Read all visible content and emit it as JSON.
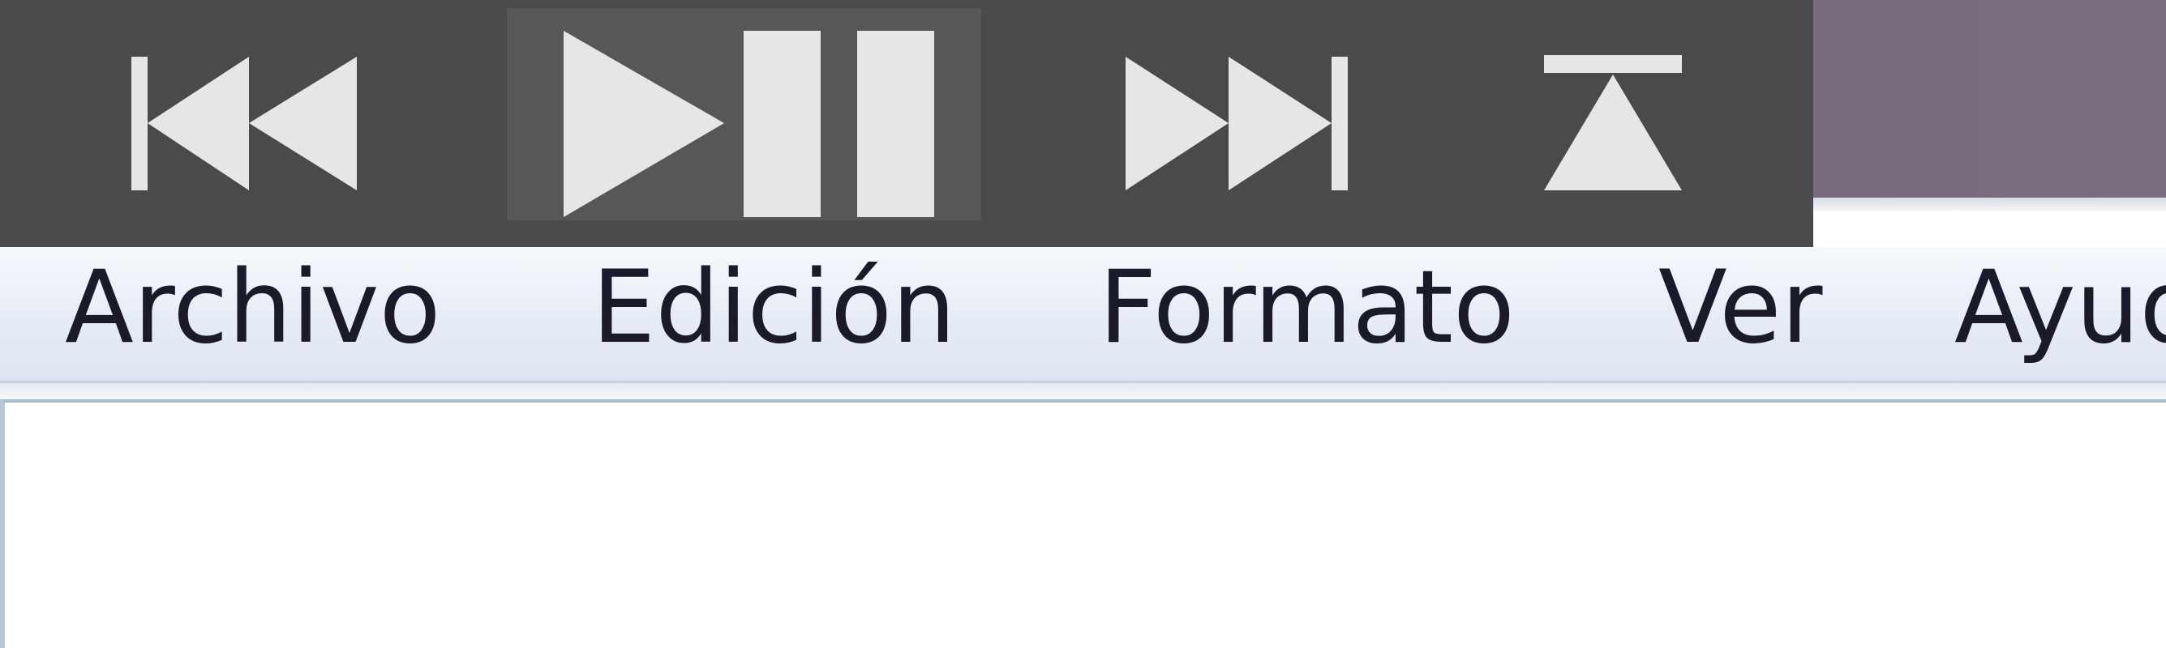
{
  "media_controls": {
    "previous_icon": "skip-previous-icon",
    "play_pause_icon": "play-pause-icon",
    "next_icon": "skip-next-icon",
    "eject_icon": "eject-icon",
    "icon_color": "#e6e6e6",
    "bar_color": "#4a4a4a"
  },
  "menubar": {
    "items": [
      {
        "label": "Archivo"
      },
      {
        "label": "Edición"
      },
      {
        "label": "Formato"
      },
      {
        "label": "Ver"
      },
      {
        "label": "Ayuda"
      }
    ]
  },
  "editor": {
    "content": ""
  }
}
